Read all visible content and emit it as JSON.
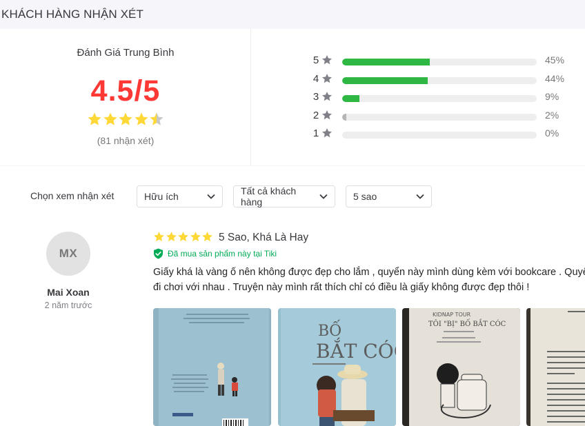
{
  "section": {
    "title": "KHÁCH HÀNG NHẬN XÉT"
  },
  "summary": {
    "avg_label": "Đánh Giá Trung Bình",
    "avg_score": "4.5/5",
    "avg_rating": 4.5,
    "review_count": "(81 nhận xét)",
    "star_color": "#fdd836",
    "breakdown": [
      {
        "stars": "5",
        "percent": "45%",
        "fraction": 0.45
      },
      {
        "stars": "4",
        "percent": "44%",
        "fraction": 0.44
      },
      {
        "stars": "3",
        "percent": "9%",
        "fraction": 0.09
      },
      {
        "stars": "2",
        "percent": "2%",
        "fraction": 0.02
      },
      {
        "stars": "1",
        "percent": "0%",
        "fraction": 0.0
      }
    ],
    "bar_color": "#2eb843"
  },
  "filters": {
    "label": "Chọn xem nhận xét",
    "sort": "Hữu ích",
    "customer": "Tất cả khách hàng",
    "stars": "5 sao"
  },
  "review": {
    "avatar_initials": "MX",
    "name": "Mai Xoan",
    "time": "2 năm trước",
    "rating": 5,
    "title": "5 Sao, Khá Là Hay",
    "verified": "Đã mua sản phẩm này tại Tiki",
    "content_line1": "Giấy khá là vàng ố nên không được đẹp cho lắm , quyển này mình dùng kèm với bookcare . Quyển nà",
    "content_line2": "đi chơi với nhau . Truyện này mình rất thích chỉ có điều là giấy không được đẹp thôi !",
    "photos": [
      {
        "alt": "book-back-cover-photo"
      },
      {
        "alt": "book-front-cover-photo",
        "cover_title": "BỐ BẮT CÓC"
      },
      {
        "alt": "book-title-page-photo",
        "page_title": "TÔI \"BỊ\" BỐ BẮT CÓC"
      },
      {
        "alt": "book-inner-page-photo"
      }
    ]
  }
}
